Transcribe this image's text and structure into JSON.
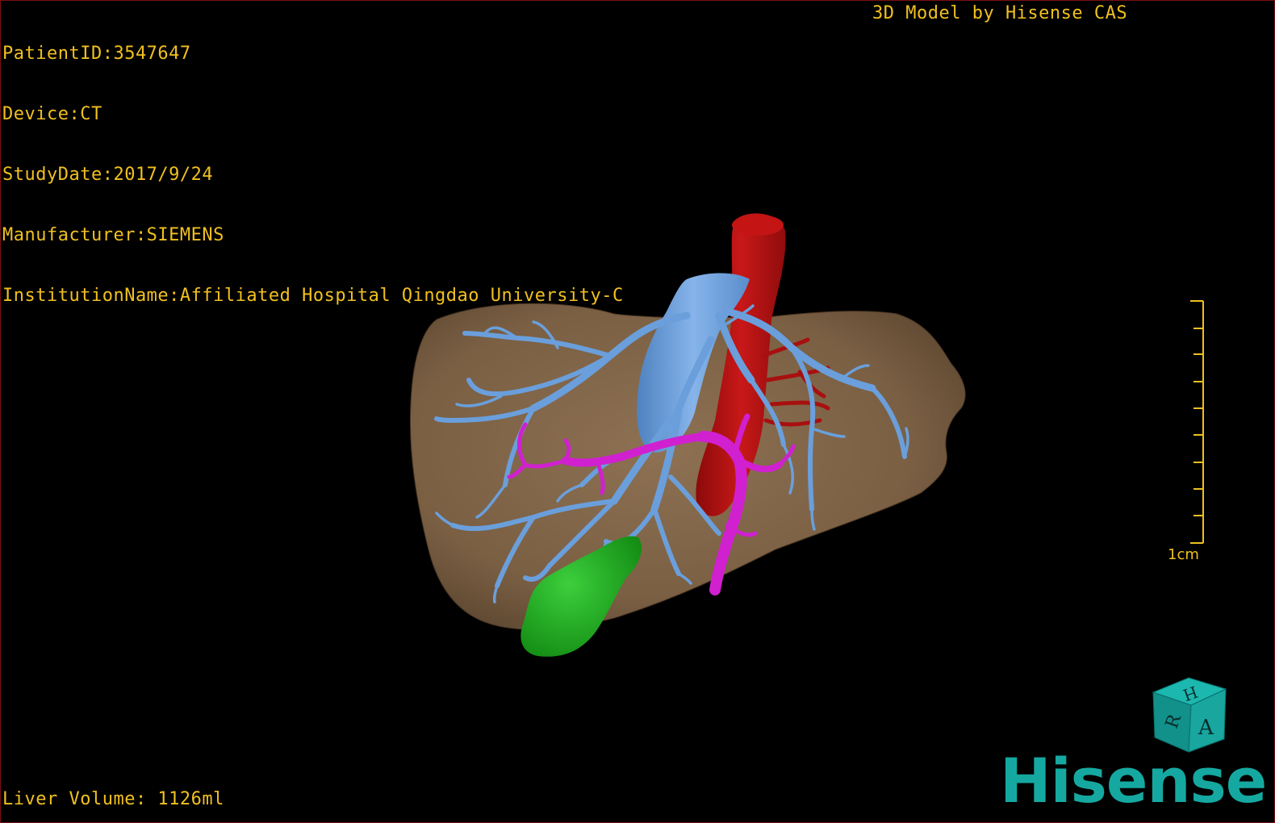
{
  "patient_info": {
    "patient_id": "PatientID:3547647",
    "device": "Device:CT",
    "study_date": "StudyDate:2017/9/24",
    "manufacturer": "Manufacturer:SIEMENS",
    "institution": "InstitutionName:Affiliated Hospital Qingdao University-C"
  },
  "header_right": "3D Model by Hisense CAS",
  "liver_volume": "Liver Volume: 1126ml",
  "scale_bar": {
    "label": "1cm"
  },
  "orientation_cube": {
    "top_letter": "H",
    "left_letter": "R",
    "front_letter": "A"
  },
  "brand": "Hisense",
  "colors": {
    "overlay_text": "#f0c020",
    "liver": "#7e6346",
    "hepatic_vein": "#6a9fdc",
    "ivc": "#6a9fdc",
    "aorta": "#b01010",
    "portal_vein": "#d020d0",
    "gallbladder": "#1faa1f",
    "brand": "#15a8a0",
    "cube": "#15a8a0"
  }
}
